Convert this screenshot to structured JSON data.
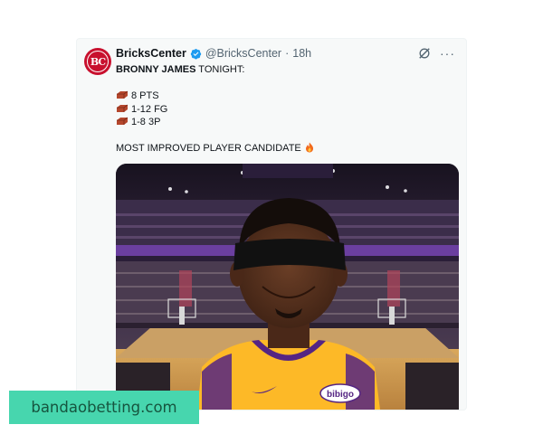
{
  "tweet": {
    "display_name": "BricksCenter",
    "avatar_text": "BC",
    "handle": "@BricksCenter",
    "separator": "·",
    "time_ago": "18h",
    "headline_bold": "BRONNY JAMES",
    "headline_rest": " TONIGHT:",
    "stats": [
      {
        "icon": "brick-icon",
        "text": "8 PTS"
      },
      {
        "icon": "brick-icon",
        "text": "1-12 FG"
      },
      {
        "icon": "brick-icon",
        "text": "1-8 3P"
      }
    ],
    "closing_line": "MOST IMPROVED PLAYER CANDIDATE",
    "closing_icon": "fire-icon",
    "jersey_text": "bibigo"
  },
  "colors": {
    "verified_blue": "#1d9bf0",
    "avatar_red": "#c8102e",
    "lakers_gold": "#fdb927",
    "lakers_purple": "#552583"
  },
  "watermark": {
    "text": "bandaobetting.com"
  }
}
